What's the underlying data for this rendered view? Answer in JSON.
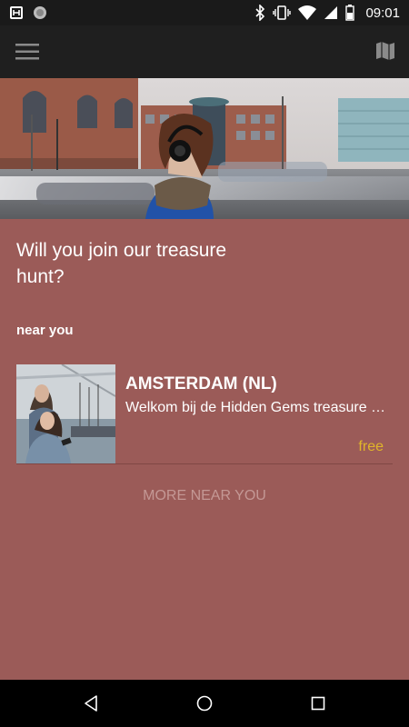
{
  "status_bar": {
    "time": "09:01",
    "icons": [
      "photo-notification-icon",
      "circle-notification-icon",
      "bluetooth-icon",
      "vibrate-icon",
      "wifi-icon",
      "signal-icon",
      "battery-icon"
    ]
  },
  "app_bar": {
    "menu_icon": "hamburger-menu-icon",
    "map_icon": "map-icon"
  },
  "hero": {
    "image": "woman-headphones-street-scene"
  },
  "main": {
    "headline": "Will you join our treasure hunt?",
    "section_label": "near you",
    "tours": [
      {
        "title": "AMSTERDAM (NL)",
        "description": "Welkom bij de Hidden Gems treasure hunt",
        "price": "free",
        "thumbnail": "two-people-on-ferris-wheel-photo"
      }
    ],
    "more_label": "MORE NEAR YOU"
  },
  "colors": {
    "background": "#9b5b58",
    "app_bar": "#1f1f1f",
    "status_bar": "#1a1a1a",
    "price": "#e0b52a",
    "more_text": "#c49895"
  },
  "nav_bar": {
    "icons": [
      "back-icon",
      "home-icon",
      "recents-icon"
    ]
  }
}
